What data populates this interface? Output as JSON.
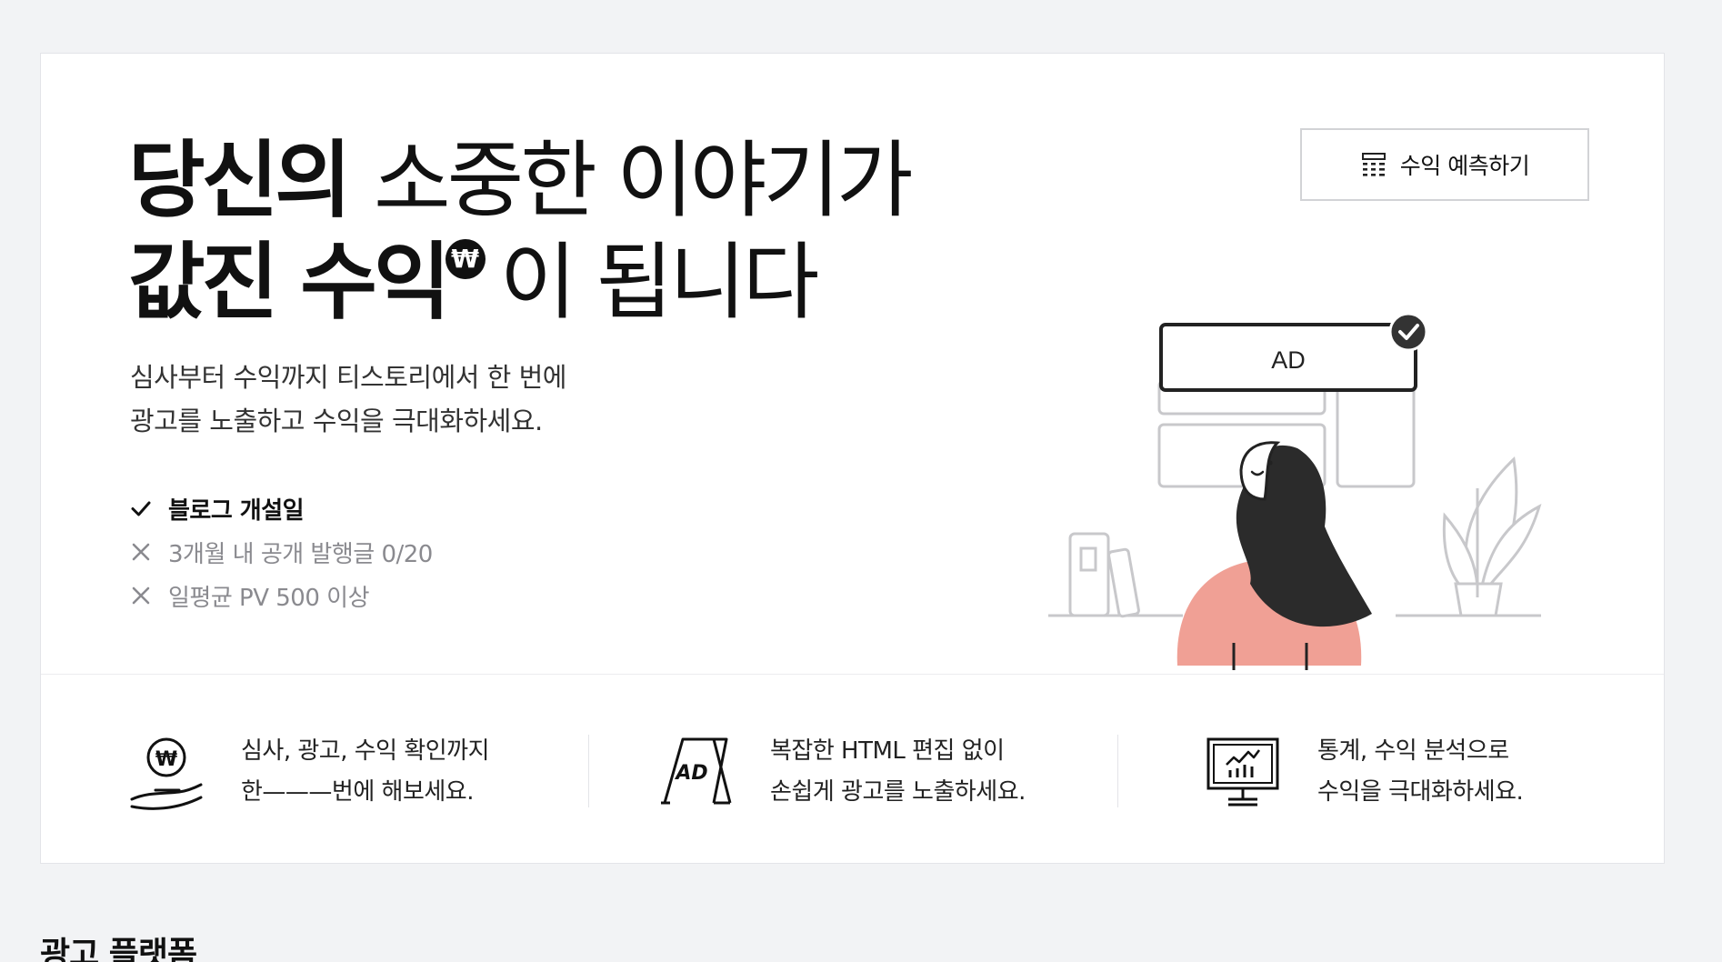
{
  "hero": {
    "headline_line1_bold": "당신의",
    "headline_line1_rest": "소중한 이야기가",
    "headline_line2_bold": "값진 수익",
    "won_symbol": "₩",
    "headline_line2_rest": "이 됩니다",
    "desc_line1": "심사부터 수익까지 티스토리에서 한 번에",
    "desc_line2": "광고를 노출하고 수익을 극대화하세요."
  },
  "criteria": [
    {
      "label": "블로그 개설일",
      "status": "done",
      "icon": "check-icon"
    },
    {
      "label": "3개월 내 공개 발행글 0/20",
      "status": "pending",
      "icon": "x-icon"
    },
    {
      "label": "일평균 PV 500 이상",
      "status": "pending",
      "icon": "x-icon"
    }
  ],
  "predict_button": {
    "label": "수익 예측하기",
    "icon": "calculator-icon"
  },
  "illustration": {
    "ad_label": "AD"
  },
  "features": [
    {
      "icon": "hand-coin-icon",
      "line1": "심사, 광고, 수익 확인까지",
      "line2": "한———번에 해보세요."
    },
    {
      "icon": "ad-sign-icon",
      "ad_text": "AD",
      "line1": "복잡한 HTML 편집 없이",
      "line2": "손쉽게 광고를 노출하세요."
    },
    {
      "icon": "monitor-chart-icon",
      "line1": "통계, 수익 분석으로",
      "line2": "수익을 극대화하세요."
    }
  ],
  "section": {
    "title": "광고 플랫폼"
  },
  "colors": {
    "background": "#f2f3f5",
    "card": "#ffffff",
    "accent_sweater": "#f0a095",
    "hair": "#2b2b2b"
  }
}
